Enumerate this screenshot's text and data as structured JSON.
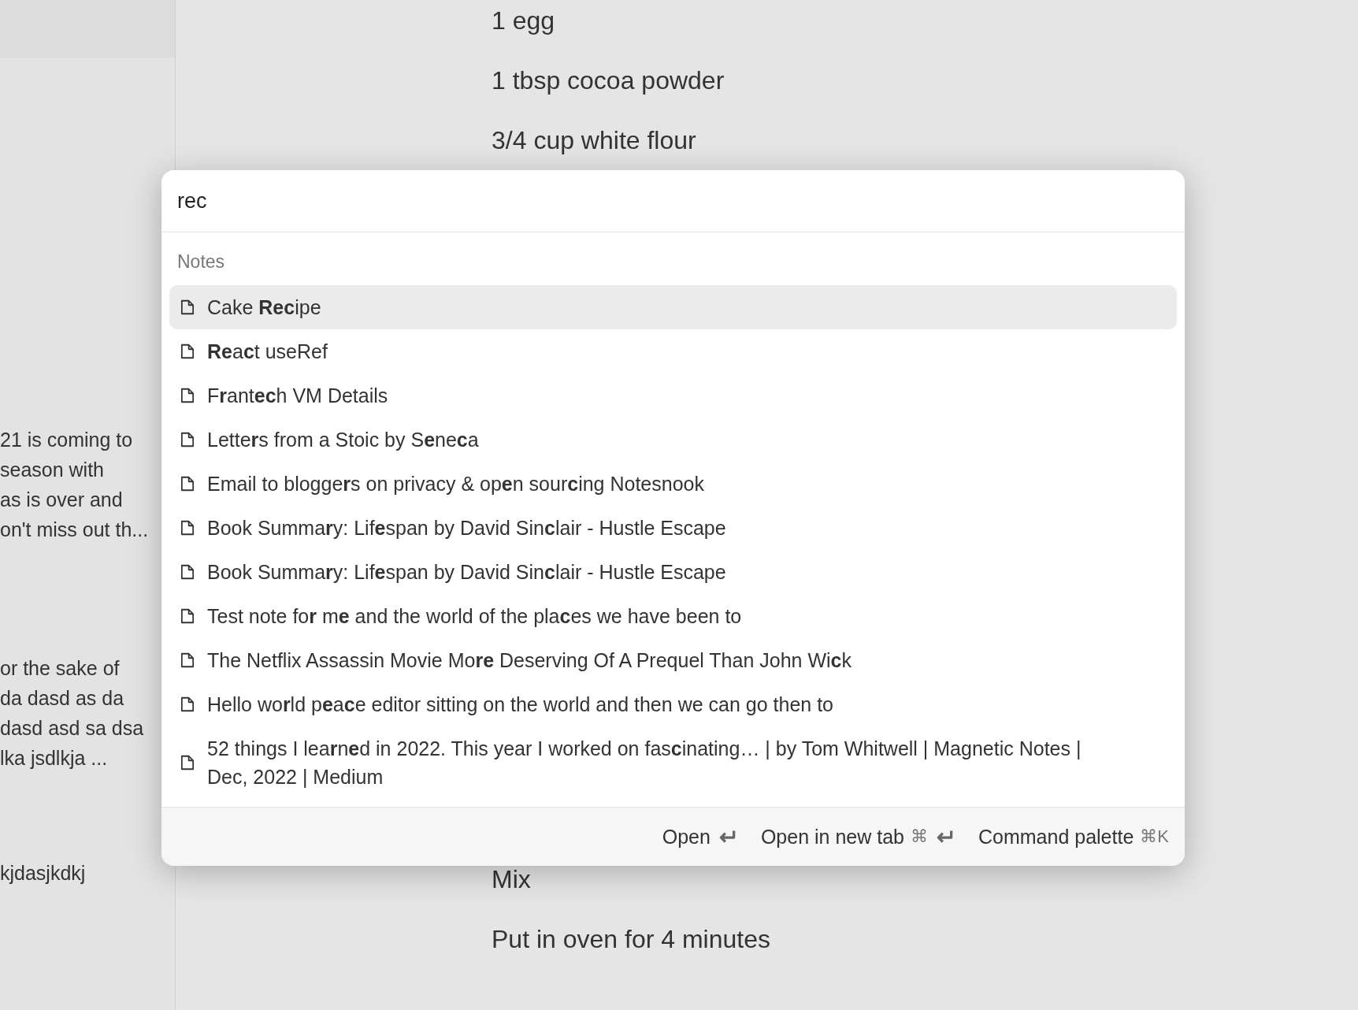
{
  "sidebar": {
    "snippets": [
      {
        "lines": [
          "21 is coming to",
          "season with",
          "as is over and",
          "on't miss out th..."
        ]
      },
      {
        "lines": [
          "or the sake of",
          "da dasd as da",
          "dasd asd sa dsa",
          "lka jsdlkja ..."
        ]
      },
      {
        "lines": [
          "kjdasjkdkj"
        ]
      }
    ]
  },
  "editor": {
    "lines_above": [
      "1 egg",
      "1 tbsp cocoa powder",
      "3/4 cup white flour"
    ],
    "lines_below": [
      "Mix",
      "Put in oven for 4 minutes"
    ]
  },
  "palette": {
    "query": "rec",
    "group_label": "Notes",
    "results": [
      {
        "title": "Cake **Rec**ipe",
        "selected": true
      },
      {
        "title": "**Re**a**c**t useRef",
        "selected": false
      },
      {
        "title": "F**r**ant**ec**h VM Details",
        "selected": false
      },
      {
        "title": "Lette**r**s from a Stoic by S**e**ne**c**a",
        "selected": false
      },
      {
        "title": "Email to blogge**r**s on privacy & op**e**n sour**c**ing Notesnook",
        "selected": false
      },
      {
        "title": "Book Summa**r**y: Lif**e**span by David Sin**c**lair - Hustle Escape",
        "selected": false
      },
      {
        "title": "Book Summa**r**y: Lif**e**span by David Sin**c**lair - Hustle Escape",
        "selected": false
      },
      {
        "title": "Test note fo**r** m**e** and the world of the pla**c**es we have been to",
        "selected": false
      },
      {
        "title": "The Netflix Assassin Movie Mo**re** Deserving Of A Prequel Than John Wi**c**k",
        "selected": false
      },
      {
        "title": "Hello wo**r**ld p**e**a**c**e editor sitting on the world and then we can go then to",
        "selected": false
      },
      {
        "title": "52 things I lea**r**n**e**d in 2022. This year I worked on fas**c**inating… | by Tom Whitwell | Magnetic Notes | Dec, 2022 | Medium",
        "selected": false
      }
    ],
    "footer_actions": [
      {
        "label": "Open",
        "keys": [
          {
            "kind": "enter"
          }
        ]
      },
      {
        "label": "Open in new tab",
        "keys": [
          {
            "kind": "text",
            "text": "⌘"
          },
          {
            "kind": "enter"
          }
        ]
      },
      {
        "label": "Command palette",
        "keys": [
          {
            "kind": "text",
            "text": "⌘K"
          }
        ]
      }
    ]
  }
}
